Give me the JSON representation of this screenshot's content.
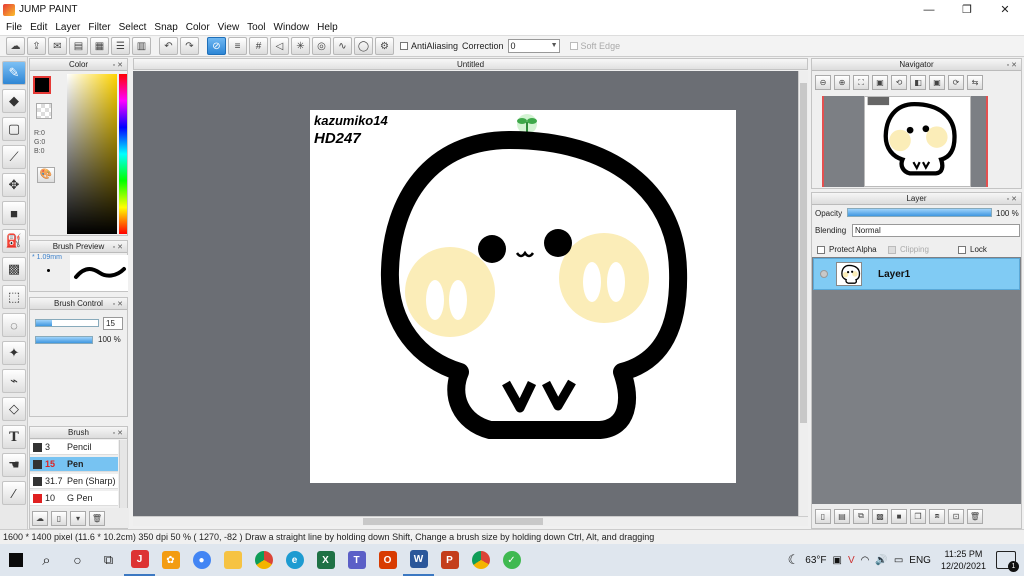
{
  "window": {
    "title": "JUMP PAINT",
    "minimize": "—",
    "maximize": "❐",
    "close": "✕"
  },
  "menu": [
    "File",
    "Edit",
    "Layer",
    "Filter",
    "Select",
    "Snap",
    "Color",
    "View",
    "Tool",
    "Window",
    "Help"
  ],
  "toolbar": {
    "antialias_label": "AntiAliasing",
    "correction_label": "Correction",
    "correction_value": "0",
    "soft_edge_label": "Soft Edge"
  },
  "color_panel": {
    "title": "Color",
    "r": "R:0",
    "g": "G:0",
    "b": "B:0"
  },
  "brush_preview": {
    "title": "Brush Preview",
    "size": "* 1.09mm"
  },
  "brush_control": {
    "title": "Brush Control",
    "size_value": "15",
    "opacity_value": "100 %",
    "size_fraction": 0.25,
    "opacity_fraction": 1.0
  },
  "brush_panel": {
    "title": "Brush",
    "items": [
      {
        "num": "3",
        "name": "Pencil",
        "color": "#333333"
      },
      {
        "num": "15",
        "name": "Pen",
        "color": "#333333",
        "selected": true
      },
      {
        "num": "31.7",
        "name": "Pen (Sharp)",
        "color": "#333333"
      },
      {
        "num": "10",
        "name": "G Pen",
        "color": "#e02020"
      }
    ]
  },
  "canvas": {
    "title": "Untitled",
    "signature_line1": "kazumiko14",
    "signature_line2": "HD247"
  },
  "navigator": {
    "title": "Navigator"
  },
  "layer_panel": {
    "title": "Layer",
    "opacity_label": "Opacity",
    "opacity_value": "100 %",
    "blending_label": "Blending",
    "blending_value": "Normal",
    "protect_alpha": "Protect Alpha",
    "clipping": "Clipping",
    "lock": "Lock",
    "layer_name": "Layer1"
  },
  "status": {
    "text": "1600 * 1400 pixel   (11.6 * 10.2cm)   350 dpi   50 %   ( 1270, -82 )   Draw a straight line by holding down Shift, Change a brush size by holding down Ctrl, Alt, and dragging"
  },
  "taskbar": {
    "weather": "63°F",
    "lang": "ENG",
    "time": "11:25 PM",
    "date": "12/20/2021",
    "notification_count": "1"
  },
  "colors": {
    "accent": "#2f86d4",
    "selected_row": "#77c3f2",
    "workspace": "#6b6e74"
  }
}
